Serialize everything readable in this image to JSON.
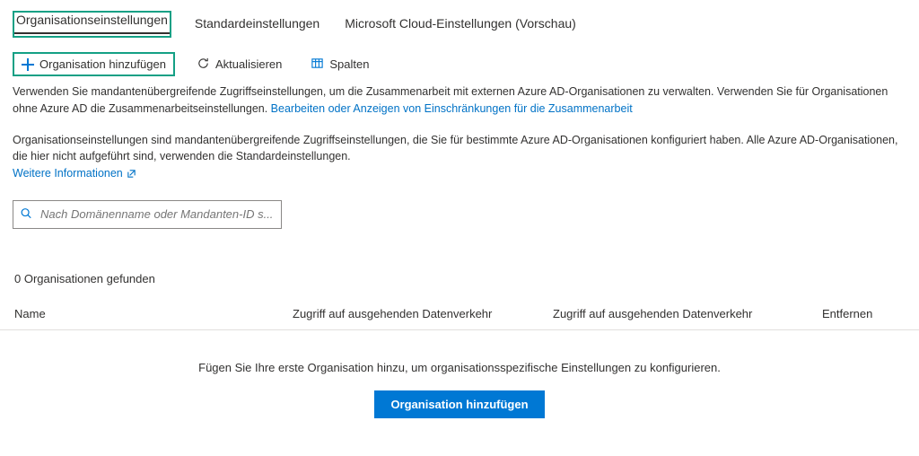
{
  "tabs": {
    "org": "Organisationseinstellungen",
    "default": "Standardeinstellungen",
    "cloud": "Microsoft Cloud-Einstellungen (Vorschau)"
  },
  "toolbar": {
    "addOrg": "Organisation hinzufügen",
    "refresh": "Aktualisieren",
    "columns": "Spalten"
  },
  "description": {
    "line1a": "Verwenden Sie mandantenübergreifende Zugriffseinstellungen, um die Zusammenarbeit mit externen Azure AD-Organisationen zu verwalten. Verwenden Sie für Organisationen ohne Azure AD die Zusammenarbeitseinstellungen. ",
    "line1link": "Bearbeiten oder Anzeigen von Einschränkungen für die Zusammenarbeit",
    "line2": "Organisationseinstellungen sind mandantenübergreifende Zugriffseinstellungen, die Sie für bestimmte Azure AD-Organisationen konfiguriert haben. Alle Azure AD-Organisationen, die hier nicht aufgeführt sind, verwenden die Standardeinstellungen.",
    "learnMore": "Weitere Informationen"
  },
  "search": {
    "placeholder": "Nach Domänenname oder Mandanten-ID s..."
  },
  "resultsCount": "0 Organisationen gefunden",
  "tableHeaders": {
    "name": "Name",
    "outbound1": "Zugriff auf ausgehenden Datenverkehr",
    "outbound2": "Zugriff auf ausgehenden Datenverkehr",
    "remove": "Entfernen"
  },
  "empty": {
    "text": "Fügen Sie Ihre erste Organisation hinzu, um organisationsspezifische Einstellungen zu konfigurieren.",
    "button": "Organisation hinzufügen"
  }
}
